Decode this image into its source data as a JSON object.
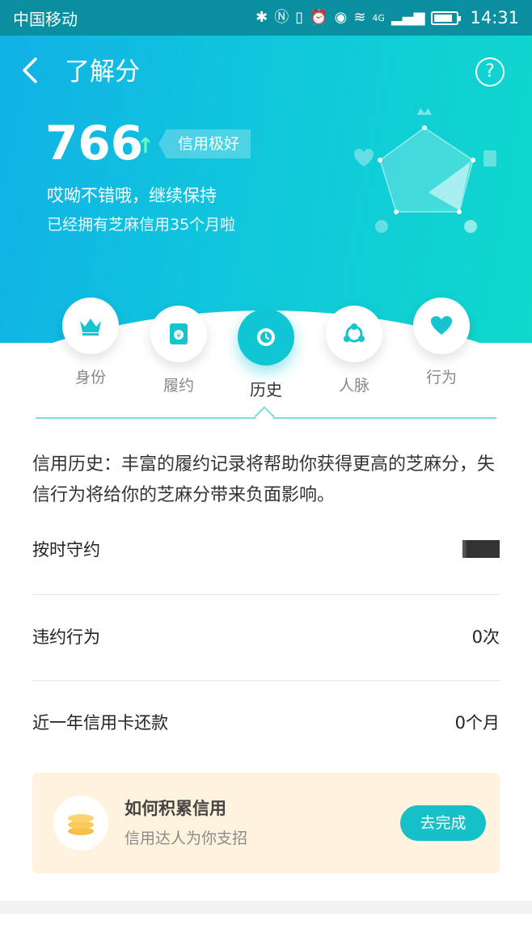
{
  "status_bar": {
    "carrier": "中国移动",
    "time": "14:31",
    "network": "4G"
  },
  "header": {
    "title": "了解分",
    "help_label": "?"
  },
  "score": {
    "value": "766",
    "trend_arrow": "↑",
    "level": "信用极好",
    "slogan": "哎呦不错哦，继续保持",
    "months_text": "已经拥有芝麻信用35个月啦"
  },
  "tabs": [
    {
      "label": "身份",
      "icon": "crown-icon"
    },
    {
      "label": "履约",
      "icon": "bill-icon"
    },
    {
      "label": "历史",
      "icon": "clock-icon",
      "active": true
    },
    {
      "label": "人脉",
      "icon": "network-icon"
    },
    {
      "label": "行为",
      "icon": "heart-icon"
    }
  ],
  "description": "信用历史：丰富的履约记录将帮助你获得更高的芝麻分，失信行为将给你的芝麻分带来负面影响。",
  "rows": [
    {
      "label": "按时守约",
      "value": ""
    },
    {
      "label": "违约行为",
      "value": "0次"
    },
    {
      "label": "近一年信用卡还款",
      "value": "0个月"
    }
  ],
  "card": {
    "title": "如何积累信用",
    "subtitle": "信用达人为你支招",
    "button": "去完成",
    "icon": "coins-icon"
  },
  "colors": {
    "accent": "#11c6d4",
    "card_bg": "#fff3dd",
    "button": "#15c1c6"
  }
}
